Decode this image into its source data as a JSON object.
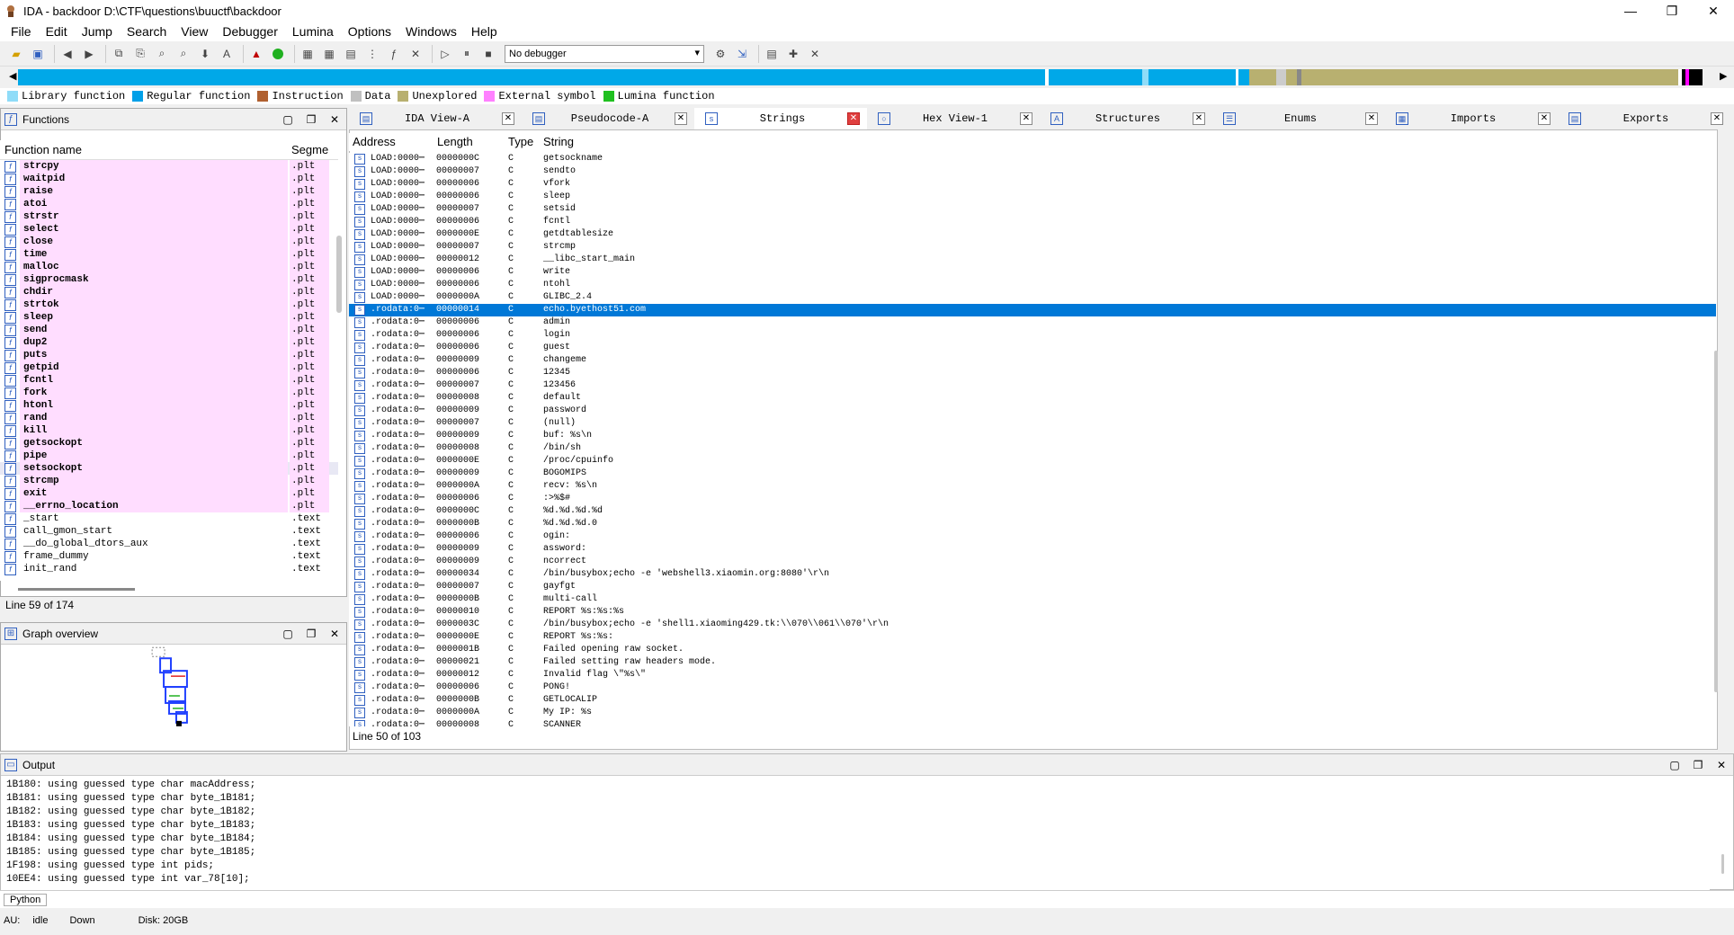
{
  "window": {
    "title": "IDA - backdoor D:\\CTF\\questions\\buuctf\\backdoor",
    "controls": [
      "—",
      "❐",
      "✕"
    ]
  },
  "menu": [
    "File",
    "Edit",
    "Jump",
    "Search",
    "View",
    "Debugger",
    "Lumina",
    "Options",
    "Windows",
    "Help"
  ],
  "toolbar": {
    "debugger_select": "No debugger"
  },
  "navbar": {
    "segments": [
      {
        "color": "#00a8e8",
        "frac": 0.605
      },
      {
        "color": "#ffffff",
        "frac": 0.002
      },
      {
        "color": "#00a8e8",
        "frac": 0.055
      },
      {
        "color": "#8fdcf8",
        "frac": 0.004
      },
      {
        "color": "#00a8e8",
        "frac": 0.051
      },
      {
        "color": "#ffffff",
        "frac": 0.002
      },
      {
        "color": "#00a8e8",
        "frac": 0.006
      },
      {
        "color": "#b8b070",
        "frac": 0.016
      },
      {
        "color": "#cccccc",
        "frac": 0.006
      },
      {
        "color": "#b8b070",
        "frac": 0.006
      },
      {
        "color": "#888888",
        "frac": 0.003
      },
      {
        "color": "#b8b070",
        "frac": 0.222
      },
      {
        "color": "#ffffff",
        "frac": 0.002
      },
      {
        "color": "#000000",
        "frac": 0.002
      },
      {
        "color": "#ff00ff",
        "frac": 0.002
      },
      {
        "color": "#000000",
        "frac": 0.008
      }
    ]
  },
  "legend": [
    {
      "label": "Library function",
      "color": "#8fdcf8"
    },
    {
      "label": "Regular function",
      "color": "#00a0e8"
    },
    {
      "label": "Instruction",
      "color": "#b06030"
    },
    {
      "label": "Data",
      "color": "#c0c0c0"
    },
    {
      "label": "Unexplored",
      "color": "#b8b070"
    },
    {
      "label": "External symbol",
      "color": "#ff80ff"
    },
    {
      "label": "Lumina function",
      "color": "#20c020"
    }
  ],
  "functions_pane": {
    "title": "Functions",
    "columns": [
      "Function name",
      "Segme"
    ],
    "rows": [
      {
        "name": "strcpy",
        "seg": ".plt",
        "bold": true
      },
      {
        "name": "waitpid",
        "seg": ".plt",
        "bold": true
      },
      {
        "name": "raise",
        "seg": ".plt",
        "bold": true
      },
      {
        "name": "atoi",
        "seg": ".plt",
        "bold": true
      },
      {
        "name": "strstr",
        "seg": ".plt",
        "bold": true
      },
      {
        "name": "select",
        "seg": ".plt",
        "bold": true
      },
      {
        "name": "close",
        "seg": ".plt",
        "bold": true
      },
      {
        "name": "time",
        "seg": ".plt",
        "bold": true
      },
      {
        "name": "malloc",
        "seg": ".plt",
        "bold": true
      },
      {
        "name": "sigprocmask",
        "seg": ".plt",
        "bold": true
      },
      {
        "name": "chdir",
        "seg": ".plt",
        "bold": true
      },
      {
        "name": "strtok",
        "seg": ".plt",
        "bold": true
      },
      {
        "name": "sleep",
        "seg": ".plt",
        "bold": true
      },
      {
        "name": "send",
        "seg": ".plt",
        "bold": true
      },
      {
        "name": "dup2",
        "seg": ".plt",
        "bold": true
      },
      {
        "name": "puts",
        "seg": ".plt",
        "bold": true
      },
      {
        "name": "getpid",
        "seg": ".plt",
        "bold": true
      },
      {
        "name": "fcntl",
        "seg": ".plt",
        "bold": true
      },
      {
        "name": "fork",
        "seg": ".plt",
        "bold": true
      },
      {
        "name": "htonl",
        "seg": ".plt",
        "bold": true
      },
      {
        "name": "rand",
        "seg": ".plt",
        "bold": true
      },
      {
        "name": "kill",
        "seg": ".plt",
        "bold": true
      },
      {
        "name": "getsockopt",
        "seg": ".plt",
        "bold": true
      },
      {
        "name": "pipe",
        "seg": ".plt",
        "bold": true
      },
      {
        "name": "setsockopt",
        "seg": ".plt",
        "bold": true
      },
      {
        "name": "strcmp",
        "seg": ".plt",
        "bold": true
      },
      {
        "name": "exit",
        "seg": ".plt",
        "bold": true
      },
      {
        "name": "__errno_location",
        "seg": ".plt",
        "bold": true
      },
      {
        "name": "_start",
        "seg": ".text",
        "bold": false
      },
      {
        "name": "call_gmon_start",
        "seg": ".text",
        "bold": false
      },
      {
        "name": "__do_global_dtors_aux",
        "seg": ".text",
        "bold": false
      },
      {
        "name": "frame_dummy",
        "seg": ".text",
        "bold": false
      },
      {
        "name": "init_rand",
        "seg": ".text",
        "bold": false
      }
    ],
    "status": "Line 59 of 174"
  },
  "graph_pane": {
    "title": "Graph overview"
  },
  "tabs": [
    {
      "label": "IDA View-A",
      "icon": "▤",
      "active": false
    },
    {
      "label": "Pseudocode-A",
      "icon": "▤",
      "active": false
    },
    {
      "label": "Strings",
      "icon": "s",
      "active": true
    },
    {
      "label": "Hex View-1",
      "icon": "○",
      "active": false
    },
    {
      "label": "Structures",
      "icon": "A",
      "active": false
    },
    {
      "label": "Enums",
      "icon": "☰",
      "active": false
    },
    {
      "label": "Imports",
      "icon": "▦",
      "active": false
    },
    {
      "label": "Exports",
      "icon": "▤",
      "active": false
    }
  ],
  "strings": {
    "columns": [
      "Address",
      "Length",
      "Type",
      "String"
    ],
    "rows": [
      {
        "addr": "LOAD:0000⋯",
        "len": "0000000C",
        "type": "C",
        "str": "getsockname"
      },
      {
        "addr": "LOAD:0000⋯",
        "len": "00000007",
        "type": "C",
        "str": "sendto"
      },
      {
        "addr": "LOAD:0000⋯",
        "len": "00000006",
        "type": "C",
        "str": "vfork"
      },
      {
        "addr": "LOAD:0000⋯",
        "len": "00000006",
        "type": "C",
        "str": "sleep"
      },
      {
        "addr": "LOAD:0000⋯",
        "len": "00000007",
        "type": "C",
        "str": "setsid"
      },
      {
        "addr": "LOAD:0000⋯",
        "len": "00000006",
        "type": "C",
        "str": "fcntl"
      },
      {
        "addr": "LOAD:0000⋯",
        "len": "0000000E",
        "type": "C",
        "str": "getdtablesize"
      },
      {
        "addr": "LOAD:0000⋯",
        "len": "00000007",
        "type": "C",
        "str": "strcmp"
      },
      {
        "addr": "LOAD:0000⋯",
        "len": "00000012",
        "type": "C",
        "str": "__libc_start_main"
      },
      {
        "addr": "LOAD:0000⋯",
        "len": "00000006",
        "type": "C",
        "str": "write"
      },
      {
        "addr": "LOAD:0000⋯",
        "len": "00000006",
        "type": "C",
        "str": "ntohl"
      },
      {
        "addr": "LOAD:0000⋯",
        "len": "0000000A",
        "type": "C",
        "str": "GLIBC_2.4"
      },
      {
        "addr": ".rodata:0⋯",
        "len": "00000014",
        "type": "C",
        "str": "echo.byethost51.com",
        "selected": true
      },
      {
        "addr": ".rodata:0⋯",
        "len": "00000006",
        "type": "C",
        "str": "admin"
      },
      {
        "addr": ".rodata:0⋯",
        "len": "00000006",
        "type": "C",
        "str": "login"
      },
      {
        "addr": ".rodata:0⋯",
        "len": "00000006",
        "type": "C",
        "str": "guest"
      },
      {
        "addr": ".rodata:0⋯",
        "len": "00000009",
        "type": "C",
        "str": "changeme"
      },
      {
        "addr": ".rodata:0⋯",
        "len": "00000006",
        "type": "C",
        "str": "12345"
      },
      {
        "addr": ".rodata:0⋯",
        "len": "00000007",
        "type": "C",
        "str": "123456"
      },
      {
        "addr": ".rodata:0⋯",
        "len": "00000008",
        "type": "C",
        "str": "default"
      },
      {
        "addr": ".rodata:0⋯",
        "len": "00000009",
        "type": "C",
        "str": "password"
      },
      {
        "addr": ".rodata:0⋯",
        "len": "00000007",
        "type": "C",
        "str": "(null)"
      },
      {
        "addr": ".rodata:0⋯",
        "len": "00000009",
        "type": "C",
        "str": "buf: %s\\n"
      },
      {
        "addr": ".rodata:0⋯",
        "len": "00000008",
        "type": "C",
        "str": "/bin/sh"
      },
      {
        "addr": ".rodata:0⋯",
        "len": "0000000E",
        "type": "C",
        "str": "/proc/cpuinfo"
      },
      {
        "addr": ".rodata:0⋯",
        "len": "00000009",
        "type": "C",
        "str": "BOGOMIPS"
      },
      {
        "addr": ".rodata:0⋯",
        "len": "0000000A",
        "type": "C",
        "str": "recv: %s\\n"
      },
      {
        "addr": ".rodata:0⋯",
        "len": "00000006",
        "type": "C",
        "str": ":>%$#"
      },
      {
        "addr": ".rodata:0⋯",
        "len": "0000000C",
        "type": "C",
        "str": "%d.%d.%d.%d"
      },
      {
        "addr": ".rodata:0⋯",
        "len": "0000000B",
        "type": "C",
        "str": "%d.%d.%d.0"
      },
      {
        "addr": ".rodata:0⋯",
        "len": "00000006",
        "type": "C",
        "str": "ogin:"
      },
      {
        "addr": ".rodata:0⋯",
        "len": "00000009",
        "type": "C",
        "str": "assword:"
      },
      {
        "addr": ".rodata:0⋯",
        "len": "00000009",
        "type": "C",
        "str": "ncorrect"
      },
      {
        "addr": ".rodata:0⋯",
        "len": "00000034",
        "type": "C",
        "str": "/bin/busybox;echo -e 'webshell3.xiaomin.org:8080'\\r\\n"
      },
      {
        "addr": ".rodata:0⋯",
        "len": "00000007",
        "type": "C",
        "str": "gayfgt"
      },
      {
        "addr": ".rodata:0⋯",
        "len": "0000000B",
        "type": "C",
        "str": "multi-call"
      },
      {
        "addr": ".rodata:0⋯",
        "len": "00000010",
        "type": "C",
        "str": "REPORT %s:%s:%s"
      },
      {
        "addr": ".rodata:0⋯",
        "len": "0000003C",
        "type": "C",
        "str": "/bin/busybox;echo -e 'shell1.xiaoming429.tk:\\\\070\\\\061\\\\070'\\r\\n"
      },
      {
        "addr": ".rodata:0⋯",
        "len": "0000000E",
        "type": "C",
        "str": "REPORT %s:%s:"
      },
      {
        "addr": ".rodata:0⋯",
        "len": "0000001B",
        "type": "C",
        "str": "Failed opening raw socket."
      },
      {
        "addr": ".rodata:0⋯",
        "len": "00000021",
        "type": "C",
        "str": "Failed setting raw headers mode."
      },
      {
        "addr": ".rodata:0⋯",
        "len": "00000012",
        "type": "C",
        "str": "Invalid flag \\\"%s\\\""
      },
      {
        "addr": ".rodata:0⋯",
        "len": "00000006",
        "type": "C",
        "str": "PONG!"
      },
      {
        "addr": ".rodata:0⋯",
        "len": "0000000B",
        "type": "C",
        "str": "GETLOCALIP"
      },
      {
        "addr": ".rodata:0⋯",
        "len": "0000000A",
        "type": "C",
        "str": "My IP: %s"
      },
      {
        "addr": ".rodata:0⋯",
        "len": "00000008",
        "type": "C",
        "str": "SCANNER"
      }
    ],
    "status": "Line 50 of 103"
  },
  "output_pane": {
    "title": "Output",
    "lines": [
      "1B180: using guessed type char macAddress;",
      "1B181: using guessed type char byte_1B181;",
      "1B182: using guessed type char byte_1B182;",
      "1B183: using guessed type char byte_1B183;",
      "1B184: using guessed type char byte_1B184;",
      "1B185: using guessed type char byte_1B185;",
      "1F198: using guessed type int pids;",
      "10EE4: using guessed type int var_78[10];"
    ],
    "python_button": "Python"
  },
  "statusbar": {
    "au": "AU:",
    "state": "idle",
    "dir": "Down",
    "disk": "Disk: 20GB"
  }
}
